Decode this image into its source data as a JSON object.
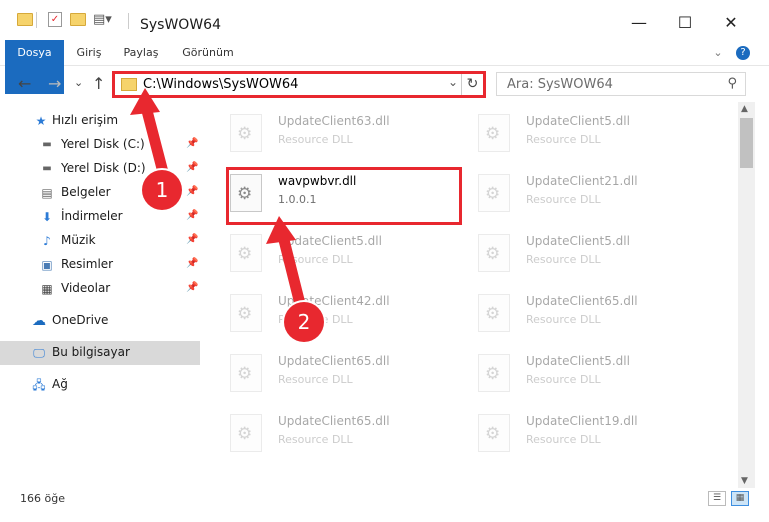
{
  "window": {
    "title": "SysWOW64",
    "minimize": "—",
    "maximize": "☐",
    "close": "✕"
  },
  "ribbon": {
    "tabs": [
      "Dosya",
      "Giriş",
      "Paylaş",
      "Görünüm"
    ],
    "collapse": "⌄",
    "help": "?"
  },
  "nav": {
    "back": "←",
    "forward": "→",
    "recent": "⌄",
    "up": "↑",
    "address": "C:\\Windows\\SysWOW64",
    "refresh": "↻",
    "search_placeholder": "Ara: SysWOW64"
  },
  "sidebar": {
    "items": [
      {
        "label": "Hızlı erişim",
        "icon": "star-icon"
      },
      {
        "label": "Yerel Disk (C:)",
        "icon": "drive-icon",
        "pinned": true
      },
      {
        "label": "Yerel Disk (D:)",
        "icon": "drive-icon",
        "pinned": true
      },
      {
        "label": "Belgeler",
        "icon": "documents-icon",
        "pinned": true
      },
      {
        "label": "İndirmeler",
        "icon": "downloads-icon",
        "pinned": true
      },
      {
        "label": "Müzik",
        "icon": "music-icon",
        "pinned": true
      },
      {
        "label": "Resimler",
        "icon": "pictures-icon",
        "pinned": true
      },
      {
        "label": "Videolar",
        "icon": "videos-icon",
        "pinned": true
      },
      {
        "label": "OneDrive",
        "icon": "cloud-icon"
      },
      {
        "label": "Bu bilgisayar",
        "icon": "computer-icon",
        "selected": true
      },
      {
        "label": "Ağ",
        "icon": "network-icon"
      }
    ]
  },
  "files": [
    {
      "name": "UpdateClient63.dll",
      "type": "Resource DLL",
      "faded": true
    },
    {
      "name": "UpdateClient5.dll",
      "type": "Resource DLL",
      "faded": true
    },
    {
      "name": "wavpwbvr.dll",
      "type": "1.0.0.1",
      "faded": false
    },
    {
      "name": "UpdateClient21.dll",
      "type": "Resource DLL",
      "faded": true
    },
    {
      "name": "UpdateClient5.dll",
      "type": "Resource DLL",
      "faded": true
    },
    {
      "name": "UpdateClient5.dll",
      "type": "Resource DLL",
      "faded": true
    },
    {
      "name": "UpdateClient42.dll",
      "type": "Resource DLL",
      "faded": true
    },
    {
      "name": "UpdateClient65.dll",
      "type": "Resource DLL",
      "faded": true
    },
    {
      "name": "UpdateClient65.dll",
      "type": "Resource DLL",
      "faded": true
    },
    {
      "name": "UpdateClient5.dll",
      "type": "Resource DLL",
      "faded": true
    },
    {
      "name": "UpdateClient65.dll",
      "type": "Resource DLL",
      "faded": true
    },
    {
      "name": "UpdateClient19.dll",
      "type": "Resource DLL",
      "faded": true
    }
  ],
  "status": {
    "count": "166 öğe"
  },
  "annotations": {
    "badge1": "1",
    "badge2": "2",
    "color": "#e8282f"
  }
}
